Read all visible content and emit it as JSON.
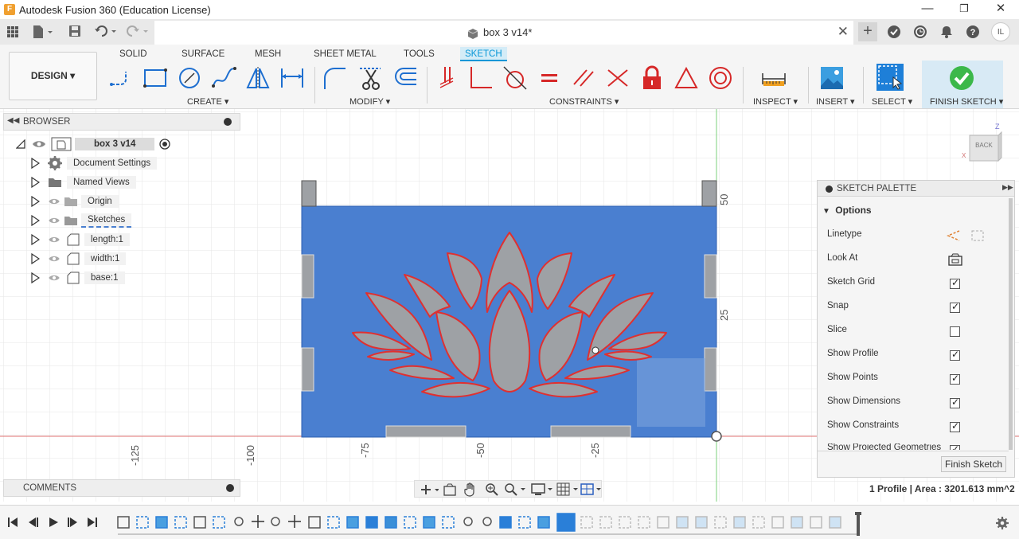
{
  "window": {
    "app_logo": "F",
    "title": "Autodesk Fusion 360 (Education License)",
    "minimize": "—",
    "maximize": "❐",
    "close": "✕"
  },
  "doc_tab": {
    "title": "box 3 v14*",
    "close": "✕"
  },
  "header_right": {
    "user_initials": "IL"
  },
  "toolbar": {
    "design_label": "DESIGN ▾",
    "workspace_tabs": [
      "SOLID",
      "SURFACE",
      "MESH",
      "SHEET METAL",
      "TOOLS",
      "SKETCH"
    ],
    "active_tab": "SKETCH",
    "groups": {
      "create": "CREATE ▾",
      "modify": "MODIFY ▾",
      "constraints": "CONSTRAINTS ▾",
      "inspect": "INSPECT ▾",
      "insert": "INSERT ▾",
      "select": "SELECT ▾",
      "finish": "FINISH SKETCH ▾"
    },
    "accent": "#0696d7"
  },
  "browser": {
    "title": "BROWSER",
    "root": "box 3 v14",
    "items": [
      {
        "label": "Document Settings",
        "icon": "gear-icon"
      },
      {
        "label": "Named Views",
        "icon": "folder-icon"
      },
      {
        "label": "Origin",
        "icon": "folder-icon"
      },
      {
        "label": "Sketches",
        "icon": "folder-icon"
      },
      {
        "label": "length:1",
        "icon": "component-icon"
      },
      {
        "label": "width:1",
        "icon": "component-icon"
      },
      {
        "label": "base:1",
        "icon": "component-icon"
      }
    ]
  },
  "canvas": {
    "ruler_x": [
      "-125",
      "-100",
      "-75",
      "-50",
      "-25"
    ],
    "ruler_y": [
      "50",
      "25"
    ],
    "viewcube_label": "BACK",
    "sketch_fill": "#4a7fd0",
    "profile_fill": "#9ea1a5",
    "outline_color": "#e03030"
  },
  "palette": {
    "title": "SKETCH PALETTE",
    "section": "Options",
    "rows": [
      {
        "label": "Linetype",
        "type": "icons"
      },
      {
        "label": "Look At",
        "type": "icon"
      },
      {
        "label": "Sketch Grid",
        "checked": true
      },
      {
        "label": "Snap",
        "checked": true
      },
      {
        "label": "Slice",
        "checked": false
      },
      {
        "label": "Show Profile",
        "checked": true
      },
      {
        "label": "Show Points",
        "checked": true
      },
      {
        "label": "Show Dimensions",
        "checked": true
      },
      {
        "label": "Show Constraints",
        "checked": true
      },
      {
        "label": "Show Projected Geometries",
        "checked": true
      }
    ],
    "finish_button": "Finish Sketch"
  },
  "comments": {
    "title": "COMMENTS"
  },
  "status": {
    "text": "1 Profile | Area : 3201.613 mm^2"
  }
}
